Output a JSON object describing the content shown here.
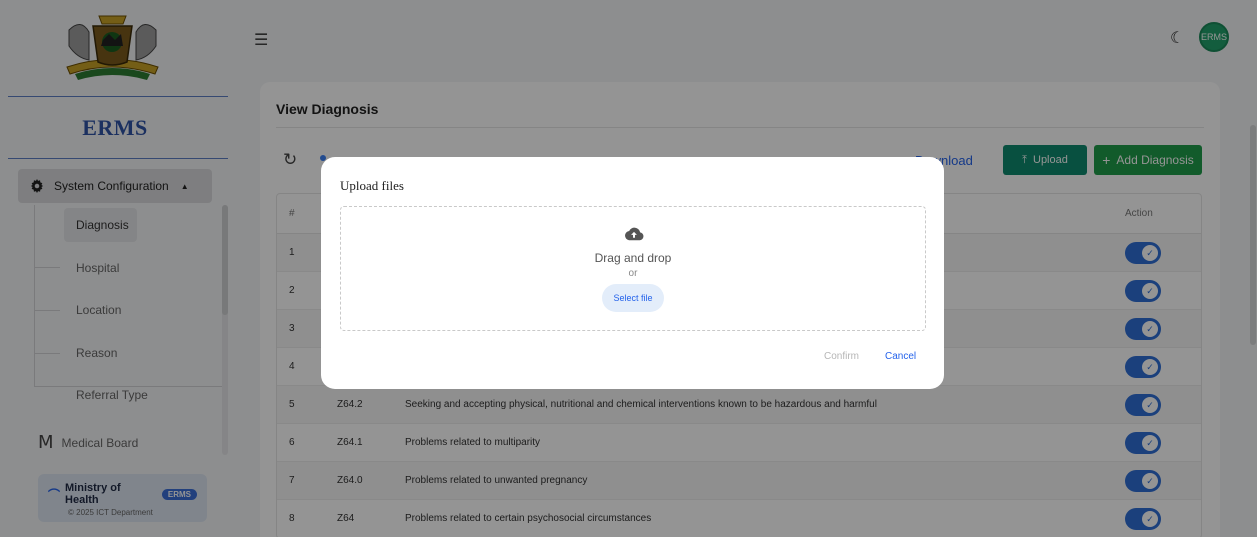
{
  "app": {
    "brand": "ERMS",
    "user_initials": "ERMS"
  },
  "sidebar": {
    "parent_label": "System Configuration",
    "items": [
      {
        "label": "Diagnosis",
        "active": true
      },
      {
        "label": "Hospital"
      },
      {
        "label": "Location"
      },
      {
        "label": "Reason"
      },
      {
        "label": "Referral Type"
      }
    ],
    "medical_board": {
      "initial": "M",
      "label": "Medical Board"
    },
    "footer": {
      "org": "Ministry of Health",
      "badge": "ERMS",
      "copyright": "© 2025 ICT Department"
    }
  },
  "page": {
    "title": "View Diagnosis",
    "download_label": "Download",
    "upload_label": "Upload",
    "add_label": "Add Diagnosis"
  },
  "table": {
    "headers": {
      "num": "#",
      "action": "Action"
    },
    "rows": [
      {
        "num": "1",
        "code": "",
        "name": "",
        "active": true
      },
      {
        "num": "2",
        "code": "",
        "name": "",
        "active": true
      },
      {
        "num": "3",
        "code": "",
        "name": "",
        "active": true
      },
      {
        "num": "4",
        "code": "",
        "name": "",
        "active": true
      },
      {
        "num": "5",
        "code": "Z64.2",
        "name": "Seeking and accepting physical, nutritional and chemical interventions known to be hazardous and harmful",
        "active": true
      },
      {
        "num": "6",
        "code": "Z64.1",
        "name": "Problems related to multiparity",
        "active": true
      },
      {
        "num": "7",
        "code": "Z64.0",
        "name": "Problems related to unwanted pregnancy",
        "active": true
      },
      {
        "num": "8",
        "code": "Z64",
        "name": "Problems related to certain psychosocial circumstances",
        "active": true
      }
    ]
  },
  "modal": {
    "title": "Upload files",
    "drag_text": "Drag and drop",
    "or_text": "or",
    "select_label": "Select file",
    "confirm_label": "Confirm",
    "cancel_label": "Cancel"
  },
  "colors": {
    "primary": "#2f6fd6",
    "upload": "#0f8a6e",
    "add": "#1f9d4a",
    "brand": "#2f54a6"
  }
}
